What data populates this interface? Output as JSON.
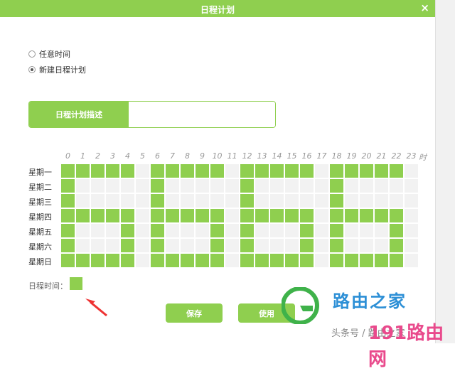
{
  "dialog": {
    "title": "日程计划",
    "close_glyph": "×"
  },
  "mode": {
    "options": [
      {
        "label": "任意时间",
        "checked": false
      },
      {
        "label": "新建日程计划",
        "checked": true
      }
    ]
  },
  "description": {
    "label": "日程计划描述",
    "value": ""
  },
  "schedule": {
    "hours": [
      "0",
      "1",
      "2",
      "3",
      "4",
      "5",
      "6",
      "7",
      "8",
      "9",
      "10",
      "11",
      "12",
      "13",
      "14",
      "15",
      "16",
      "17",
      "18",
      "19",
      "20",
      "21",
      "22",
      "23"
    ],
    "hour_unit": "时",
    "days": [
      "星期一",
      "星期二",
      "星期三",
      "星期四",
      "星期五",
      "星期六",
      "星期日"
    ],
    "active": [
      [
        0,
        1,
        2,
        3,
        4,
        6,
        7,
        8,
        9,
        10,
        12,
        13,
        14,
        15,
        16,
        18,
        19,
        20,
        21,
        22
      ],
      [
        0,
        6,
        12,
        18
      ],
      [
        0,
        6,
        12,
        18
      ],
      [
        0,
        1,
        2,
        3,
        4,
        6,
        7,
        8,
        9,
        10,
        12,
        13,
        14,
        15,
        16,
        18,
        19,
        20,
        21,
        22
      ],
      [
        0,
        4,
        6,
        10,
        12,
        16,
        18,
        22
      ],
      [
        0,
        4,
        6,
        10,
        12,
        16,
        18,
        22
      ],
      [
        0,
        1,
        2,
        3,
        4,
        6,
        7,
        8,
        9,
        10,
        12,
        13,
        14,
        15,
        16,
        18,
        19,
        20,
        21,
        22
      ]
    ],
    "active_color": "#8fcf4f",
    "inactive_color": "#f2f2f2"
  },
  "legend": {
    "label": "日程时间："
  },
  "buttons": {
    "save": "保存",
    "apply": "使用"
  },
  "watermark": {
    "brand": "路由之家",
    "bottom_left": "头条号 / 路由之家",
    "bottom_right": "191路由网"
  },
  "colors": {
    "accent": "#8fcf4f"
  }
}
